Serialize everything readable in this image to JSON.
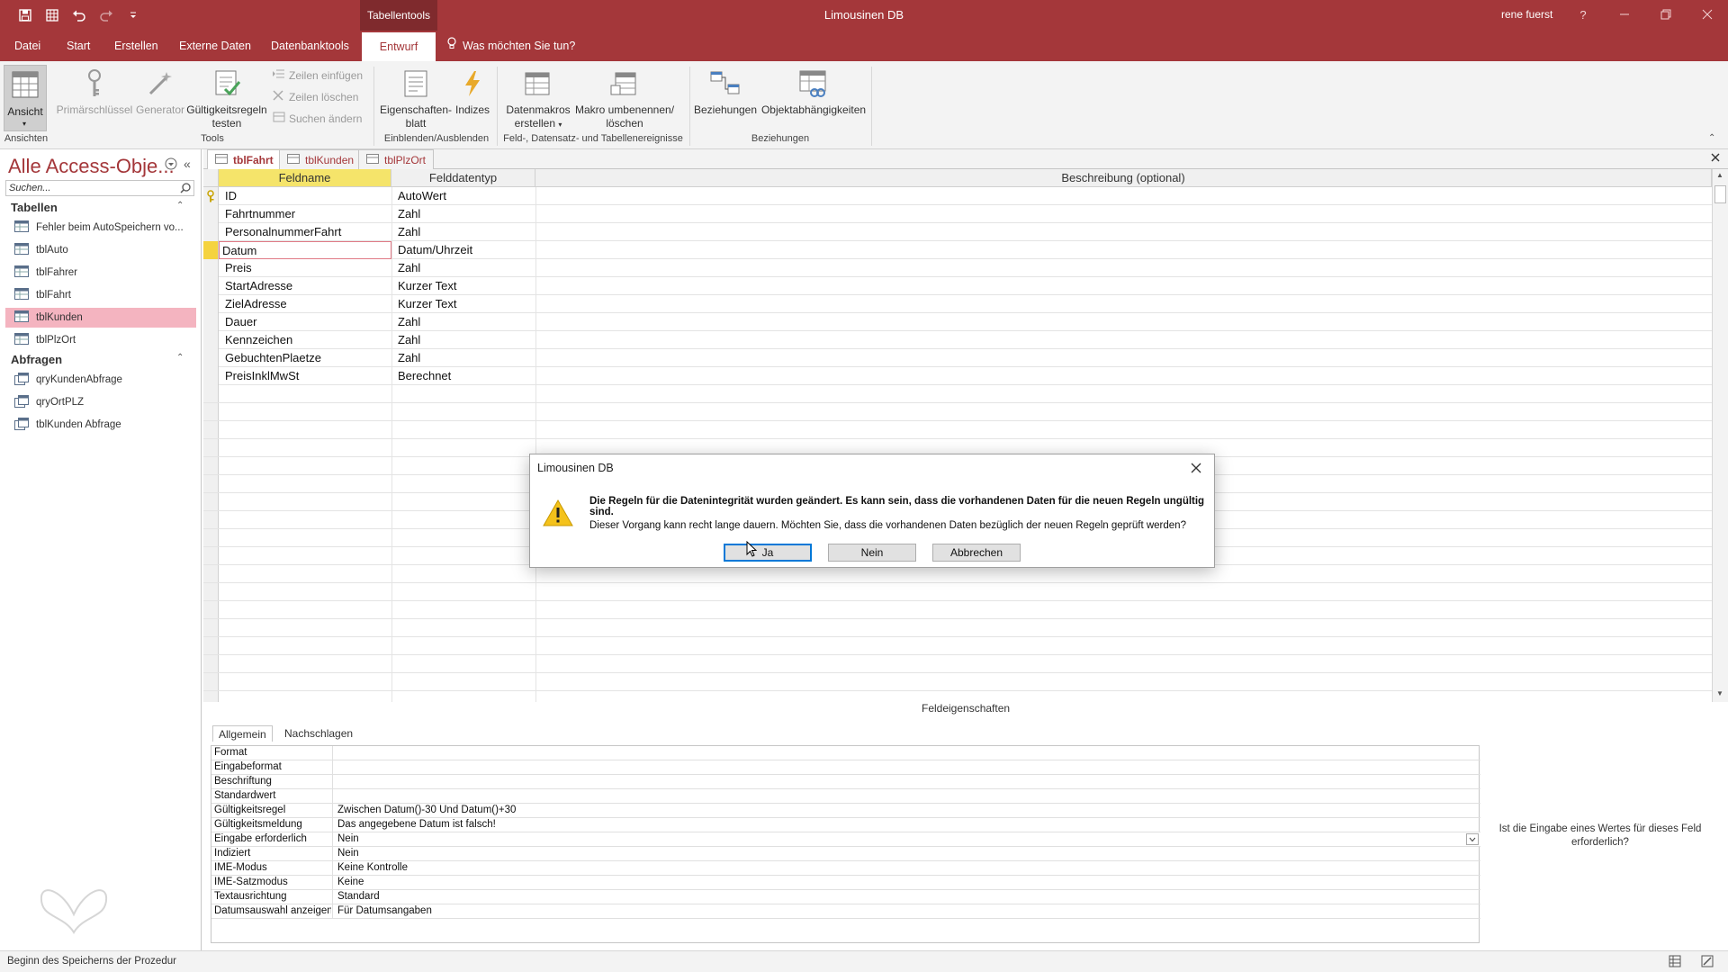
{
  "titlebar": {
    "context_tab": "Tabellentools",
    "app_title": "Limousinen DB",
    "user": "rene fuerst",
    "help": "?"
  },
  "ribbon_tabs": [
    "Datei",
    "Start",
    "Erstellen",
    "Externe Daten",
    "Datenbanktools",
    "Entwurf"
  ],
  "tell_me": "Was möchten Sie tun?",
  "ribbon": {
    "ansicht": "Ansicht",
    "primaerschluessel": "Primärschlüssel",
    "generator": "Generator",
    "gueltigkeit_1": "Gültigkeitsregeln",
    "gueltigkeit_2": "testen",
    "zeilen_einfuegen": "Zeilen einfügen",
    "zeilen_loeschen": "Zeilen löschen",
    "suchen_aendern": "Suchen ändern",
    "eigenschaften_1": "Eigenschaften-",
    "eigenschaften_2": "blatt",
    "indizes": "Indizes",
    "datenmakros_1": "Datenmakros",
    "datenmakros_2": "erstellen",
    "makro_1": "Makro umbenennen/",
    "makro_2": "löschen",
    "beziehungen": "Beziehungen",
    "objektabh": "Objektabhängigkeiten",
    "groups": {
      "ansichten": "Ansichten",
      "tools": "Tools",
      "einblenden": "Einblenden/Ausblenden",
      "ereignisse": "Feld-, Datensatz- und Tabellenereignisse",
      "beziehungen": "Beziehungen"
    }
  },
  "nav": {
    "title": "Alle Access-Obje...",
    "search_placeholder": "Suchen...",
    "sections": {
      "tabellen": "Tabellen",
      "abfragen": "Abfragen"
    },
    "tables": [
      "Fehler beim AutoSpeichern vo...",
      "tblAuto",
      "tblFahrer",
      "tblFahrt",
      "tblKunden",
      "tblPlzOrt"
    ],
    "queries": [
      "qryKundenAbfrage",
      "qryOrtPLZ",
      "tblKunden Abfrage"
    ]
  },
  "doc_tabs": [
    "tblFahrt",
    "tblKunden",
    "tblPlzOrt"
  ],
  "grid": {
    "headers": [
      "Feldname",
      "Felddatentyp",
      "Beschreibung (optional)"
    ],
    "rows": [
      [
        "ID",
        "AutoWert"
      ],
      [
        "Fahrtnummer",
        "Zahl"
      ],
      [
        "PersonalnummerFahrt",
        "Zahl"
      ],
      [
        "Datum",
        "Datum/Uhrzeit"
      ],
      [
        "Preis",
        "Zahl"
      ],
      [
        "StartAdresse",
        "Kurzer Text"
      ],
      [
        "ZielAdresse",
        "Kurzer Text"
      ],
      [
        "Dauer",
        "Zahl"
      ],
      [
        "Kennzeichen",
        "Zahl"
      ],
      [
        "GebuchtenPlaetze",
        "Zahl"
      ],
      [
        "PreisInklMwSt",
        "Berechnet"
      ]
    ]
  },
  "props": {
    "title": "Feldeigenschaften",
    "tabs": [
      "Allgemein",
      "Nachschlagen"
    ],
    "rows": [
      [
        "Format",
        ""
      ],
      [
        "Eingabeformat",
        ""
      ],
      [
        "Beschriftung",
        ""
      ],
      [
        "Standardwert",
        ""
      ],
      [
        "Gültigkeitsregel",
        "Zwischen Datum()-30 Und Datum()+30"
      ],
      [
        "Gültigkeitsmeldung",
        "Das angegebene Datum ist falsch!"
      ],
      [
        "Eingabe erforderlich",
        "Nein"
      ],
      [
        "Indiziert",
        "Nein"
      ],
      [
        "IME-Modus",
        "Keine Kontrolle"
      ],
      [
        "IME-Satzmodus",
        "Keine"
      ],
      [
        "Textausrichtung",
        "Standard"
      ],
      [
        "Datumsauswahl anzeigen",
        "Für Datumsangaben"
      ]
    ],
    "hint": "Ist die Eingabe eines Wertes für dieses Feld erforderlich?"
  },
  "status": "Beginn des Speicherns der Prozedur",
  "dialog": {
    "title": "Limousinen DB",
    "line1": "Die Regeln für die Datenintegrität wurden geändert. Es kann sein, dass die vorhandenen Daten für die neuen Regeln ungültig sind.",
    "line2": "Dieser Vorgang kann recht lange dauern. Möchten Sie, dass die vorhandenen Daten bezüglich der neuen Regeln geprüft werden?",
    "buttons": [
      "Ja",
      "Nein",
      "Abbrechen"
    ]
  },
  "colors": {
    "accent": "#a4373a",
    "selected_nav": "#f4b4c0",
    "header_highlight": "#f5e46a"
  }
}
